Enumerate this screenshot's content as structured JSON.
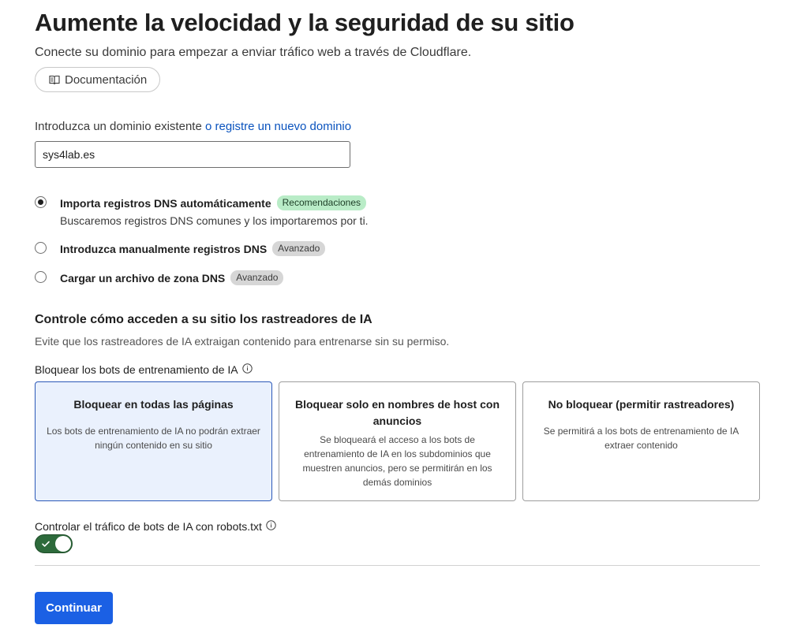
{
  "header": {
    "title": "Aumente la velocidad y la seguridad de su sitio",
    "subtitle": "Conecte su dominio para empezar a enviar tráfico web a través de Cloudflare.",
    "doc_button": "Documentación"
  },
  "domain": {
    "label_prefix": "Introduzca un dominio existente",
    "register_link": "o registre un nuevo dominio",
    "value": "sys4lab.es"
  },
  "dns_options": [
    {
      "label": "Importa registros DNS automáticamente",
      "badge": "Recomendaciones",
      "description": "Buscaremos registros DNS comunes y los importaremos por ti.",
      "selected": true
    },
    {
      "label": "Introduzca manualmente registros DNS",
      "badge": "Avanzado",
      "selected": false
    },
    {
      "label": "Cargar un archivo de zona DNS",
      "badge": "Avanzado",
      "selected": false
    }
  ],
  "ai": {
    "title": "Controle cómo acceden a su sitio los rastreadores de IA",
    "description": "Evite que los rastreadores de IA extraigan contenido para entrenarse sin su permiso.",
    "block_label": "Bloquear los bots de entrenamiento de IA",
    "options": [
      {
        "title": "Bloquear en todas las páginas",
        "description": "Los bots de entrenamiento de IA no podrán extraer ningún contenido en su sitio",
        "selected": true
      },
      {
        "title": "Bloquear solo en nombres de host con anuncios",
        "description": "Se bloqueará el acceso a los bots de entrenamiento de IA en los subdominios que muestren anuncios, pero se permitirán en los demás dominios",
        "selected": false
      },
      {
        "title": "No bloquear (permitir rastreadores)",
        "description": "Se permitirá a los bots de entrenamiento de IA extraer contenido",
        "selected": false
      }
    ],
    "robots_label": "Controlar el tráfico de bots de IA con robots.txt",
    "robots_enabled": true
  },
  "continue_button": "Continuar",
  "icons": {
    "doc": "book-icon",
    "info": "info-icon",
    "check": "check-icon"
  },
  "colors": {
    "link": "#0a53be",
    "primary": "#1b60e4",
    "toggle_on": "#2d6a3b",
    "selected_card_bg": "#eaf1fd",
    "badge_green": "#b9ecc7"
  }
}
